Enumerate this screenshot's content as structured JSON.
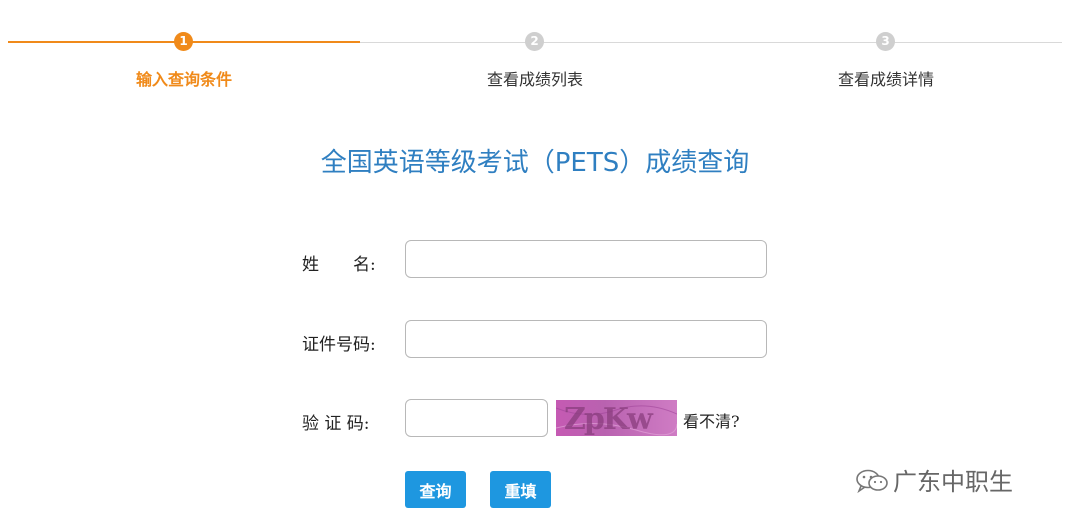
{
  "steps": [
    {
      "number": "1",
      "label": "输入查询条件",
      "state": "active"
    },
    {
      "number": "2",
      "label": "查看成绩列表",
      "state": "inactive"
    },
    {
      "number": "3",
      "label": "查看成绩详情",
      "state": "inactive"
    }
  ],
  "page": {
    "title": "全国英语等级考试（PETS）成绩查询"
  },
  "form": {
    "name_label": "姓　　名:",
    "name_value": "",
    "id_label": "证件号码:",
    "id_value": "",
    "captcha_label": "验 证 码:",
    "captcha_value": "",
    "captcha_text": "ZpKw",
    "captcha_refresh": "看不清?"
  },
  "buttons": {
    "query": "查询",
    "reset": "重填"
  },
  "watermark": {
    "text": "广东中职生",
    "icon": "wechat-icon"
  },
  "colors": {
    "accent": "#f08a1a",
    "title": "#2f7fc1",
    "button": "#1e97e0",
    "inactive": "#cfcfcf"
  }
}
